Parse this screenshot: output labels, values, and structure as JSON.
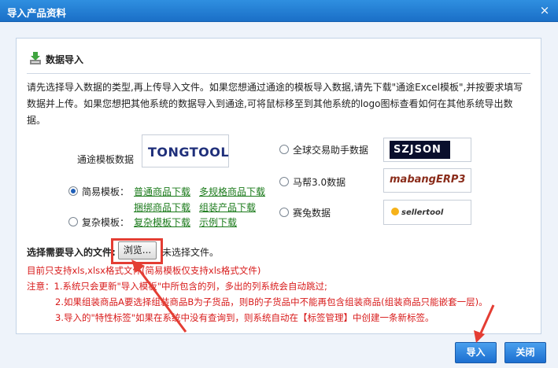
{
  "window": {
    "title": "导入产品资料",
    "close_glyph": "×"
  },
  "section": {
    "title": "数据导入",
    "icon": "download-icon"
  },
  "intro": "请先选择导入数据的类型,再上传导入文件。如果您想通过通途的模板导入数据,请先下载\"通途Excel模板\",并按要求填写数据并上传。如果您想把其他系统的数据导入到通途,可将鼠标移至到其他系统的logo图标查看如何在其他系统导出数据。",
  "tongtool": {
    "label": "通途模板数据",
    "logo_text": "TONGTOOL"
  },
  "templates": {
    "simple": {
      "label": "简易模板：",
      "checked": true,
      "links": [
        "普通商品下载",
        "多规格商品下载",
        "捆绑商品下载",
        "组装产品下载"
      ]
    },
    "complex": {
      "label": "复杂模板：",
      "checked": false,
      "links": [
        "复杂模板下载",
        "示例下载"
      ]
    }
  },
  "other_systems": [
    {
      "label": "全球交易助手数据",
      "logo_text": "SZJSON",
      "checked": false
    },
    {
      "label": "马帮3.0数据",
      "logo_text": "mabangERP3",
      "checked": false
    },
    {
      "label": "赛兔数据",
      "logo_text": "sellertool",
      "checked": false
    }
  ],
  "file": {
    "prompt": "选择需要导入的文件:",
    "browse_label": "浏览...",
    "status": "未选择文件。"
  },
  "notes": [
    "目前只支持xls,xlsx格式文件(简易模板仅支持xls格式文件)",
    "注意：1.系统只会更新\"导入模板\"中所包含的列，多出的列系统会自动跳过;",
    "2.如果组装商品A要选择组装商品B为子货品，则B的子货品中不能再包含组装商品(组装商品只能嵌套一层)。",
    "3.导入的\"特性标签\"如果在系统中没有查询到，则系统自动在【标签管理】中创建一条新标签。"
  ],
  "buttons": {
    "import": "导入",
    "close": "关闭"
  },
  "colors": {
    "title_bar": "#1a6fc7",
    "link": "#1a7a1a",
    "note": "#d81b1b",
    "highlight": "#e43d33"
  }
}
